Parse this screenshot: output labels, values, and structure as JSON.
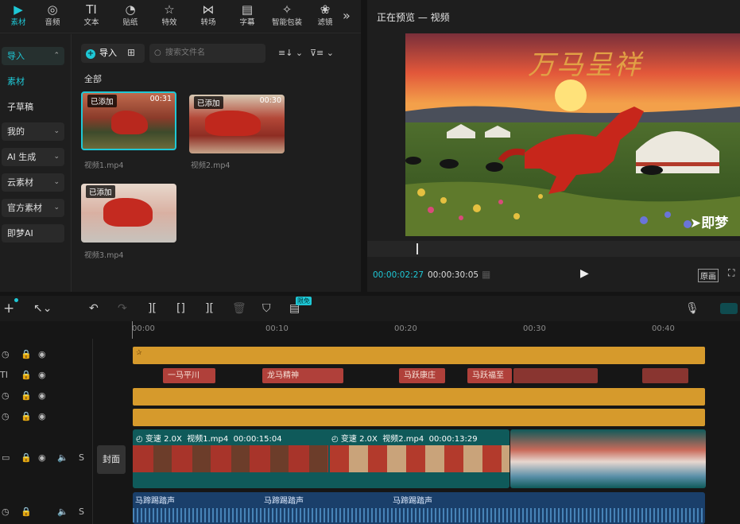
{
  "top_tabs": [
    {
      "label": "素材",
      "icon": "media-icon"
    },
    {
      "label": "音频",
      "icon": "audio-icon"
    },
    {
      "label": "文本",
      "icon": "text-icon"
    },
    {
      "label": "贴纸",
      "icon": "sticker-icon"
    },
    {
      "label": "特效",
      "icon": "effects-icon"
    },
    {
      "label": "转场",
      "icon": "transition-icon"
    },
    {
      "label": "字幕",
      "icon": "subtitle-icon"
    },
    {
      "label": "智能包装",
      "icon": "smart-pack-icon"
    },
    {
      "label": "滤镜",
      "icon": "filter-icon"
    }
  ],
  "sidebar": {
    "items": [
      "导入",
      "素材",
      "子草稿",
      "我的",
      "AI 生成",
      "云素材",
      "官方素材",
      "即梦AI"
    ]
  },
  "media": {
    "import_label": "导入",
    "search_placeholder": "搜索文件名",
    "section": "全部",
    "items": [
      {
        "name": "视频1.mp4",
        "badge": "已添加",
        "duration": "00:31"
      },
      {
        "name": "视频2.mp4",
        "badge": "已添加",
        "duration": "00:30"
      },
      {
        "name": "视频3.mp4",
        "badge": "已添加",
        "duration": ""
      }
    ]
  },
  "preview": {
    "title": "正在预览 — 视频",
    "overlay_title": "万马呈祥",
    "watermark": "即梦",
    "current_time": "00:00:02:27",
    "total_time": "00:00:30:05",
    "ratio_label": "原画"
  },
  "toolbar": {
    "badge": "限免"
  },
  "ruler": [
    "00:00",
    "00:10",
    "00:20",
    "00:30",
    "00:40"
  ],
  "text_clips": [
    "一马平川",
    "龙马精神",
    "马跃康庄",
    "马跃福至"
  ],
  "video_clips": [
    {
      "speed": "变速 2.0X",
      "name": "视频1.mp4",
      "duration": "00:00:15:04"
    },
    {
      "speed": "变速 2.0X",
      "name": "视频2.mp4",
      "duration": "00:00:13:29"
    }
  ],
  "cover_label": "封面",
  "audio_clips": [
    "马蹄踢踏声",
    "马蹄踢踏声",
    "马蹄踢踏声"
  ],
  "colors": {
    "accent": "#1ec8d6",
    "text_clip": "#b0403a",
    "effect_bar": "#d69a2c",
    "video_track": "#0f5a5a",
    "audio_track": "#1a3f6a"
  }
}
